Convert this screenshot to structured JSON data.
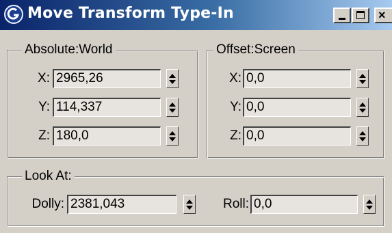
{
  "window": {
    "title": "Move Transform Type-In",
    "icon": "3dsmax-logo-icon",
    "controls": {
      "minimize": "minimize-icon",
      "maximize": "maximize-icon",
      "close": "×"
    }
  },
  "absolute": {
    "legend": "Absolute:World",
    "fields": [
      {
        "label": "X:",
        "value": "2965,26"
      },
      {
        "label": "Y:",
        "value": "114,337"
      },
      {
        "label": "Z:",
        "value": "180,0"
      }
    ]
  },
  "offset": {
    "legend": "Offset:Screen",
    "fields": [
      {
        "label": "X:",
        "value": "0,0"
      },
      {
        "label": "Y:",
        "value": "0,0"
      },
      {
        "label": "Z:",
        "value": "0,0"
      }
    ]
  },
  "lookat": {
    "legend": "Look At:",
    "dolly": {
      "label": "Dolly:",
      "value": "2381,043"
    },
    "roll": {
      "label": "Roll:",
      "value": "0,0"
    }
  }
}
